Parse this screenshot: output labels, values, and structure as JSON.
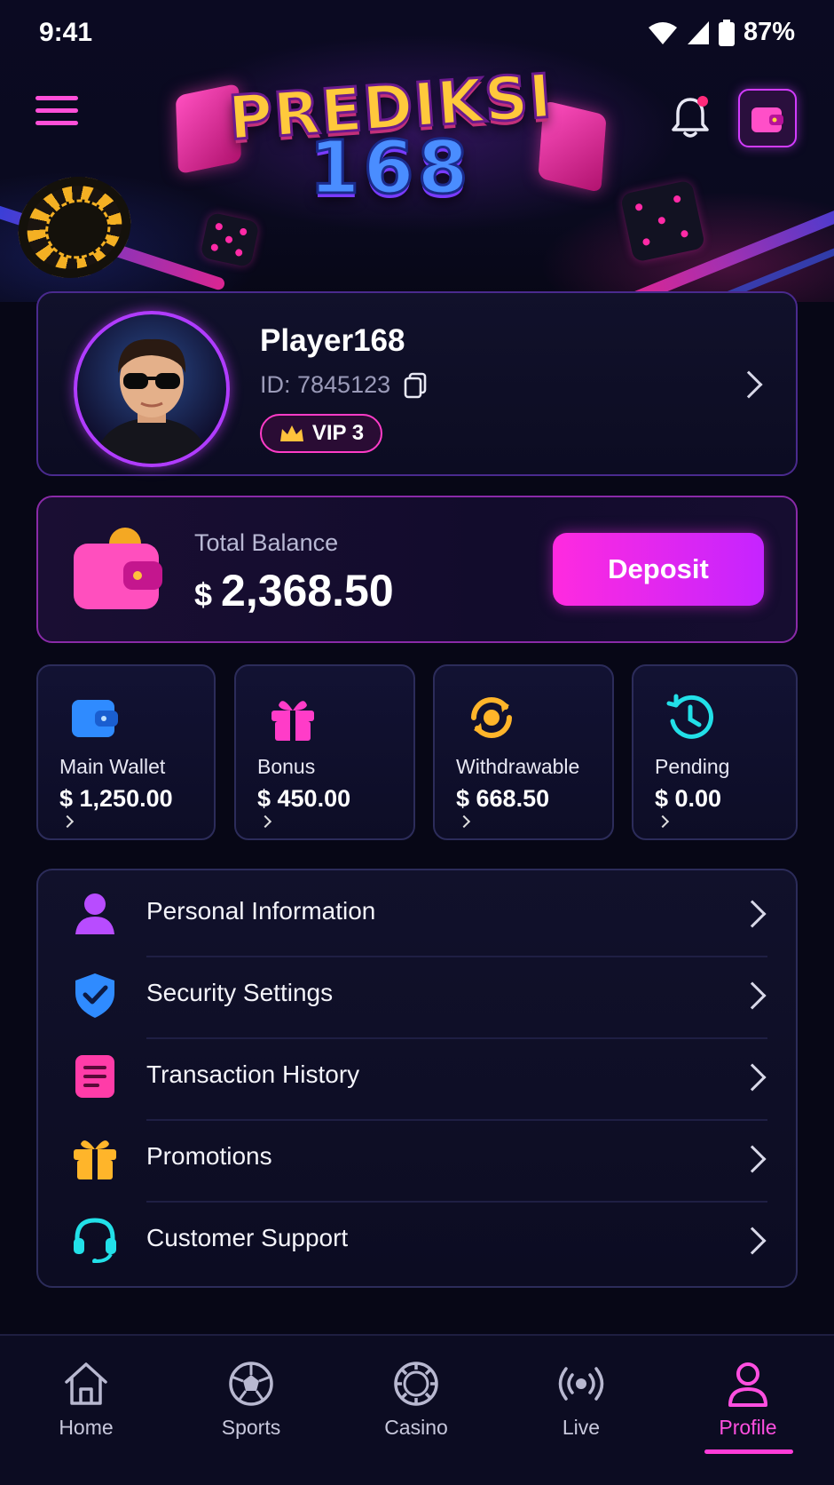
{
  "status_bar": {
    "time": "9:41",
    "battery": "87%"
  },
  "header": {
    "logo_line1": "PREDIKSI",
    "logo_line2": "168"
  },
  "profile": {
    "username": "Player168",
    "id_text": "ID: 7845123",
    "vip_label": "VIP 3"
  },
  "balance": {
    "label": "Total Balance",
    "currency": "$",
    "amount": "2,368.50",
    "deposit_label": "Deposit"
  },
  "wallets": [
    {
      "label": "Main Wallet",
      "value": "$ 1,250.00",
      "icon": "wallet-icon",
      "color": "#2f8bff"
    },
    {
      "label": "Bonus",
      "value": "$ 450.00",
      "icon": "gift-icon",
      "color": "#ff3cc8"
    },
    {
      "label": "Withdrawable",
      "value": "$ 668.50",
      "icon": "refresh-coin-icon",
      "color": "#ffb52a"
    },
    {
      "label": "Pending",
      "value": "$ 0.00",
      "icon": "clock-icon",
      "color": "#22e0e8"
    }
  ],
  "menu": [
    {
      "label": "Personal Information",
      "icon": "person-icon",
      "color": "#b84cff"
    },
    {
      "label": "Security Settings",
      "icon": "shield-check-icon",
      "color": "#2f8bff"
    },
    {
      "label": "Transaction History",
      "icon": "document-icon",
      "color": "#ff3ca8"
    },
    {
      "label": "Promotions",
      "icon": "gift-icon",
      "color": "#ffb52a"
    },
    {
      "label": "Customer Support",
      "icon": "headset-icon",
      "color": "#22e0e8"
    }
  ],
  "nav": [
    {
      "label": "Home",
      "icon": "home-icon"
    },
    {
      "label": "Sports",
      "icon": "soccer-ball-icon"
    },
    {
      "label": "Casino",
      "icon": "casino-chip-icon"
    },
    {
      "label": "Live",
      "icon": "broadcast-icon"
    },
    {
      "label": "Profile",
      "icon": "user-icon",
      "active": true
    }
  ],
  "colors": {
    "accent": "#ff3cd8",
    "background": "#070716"
  }
}
